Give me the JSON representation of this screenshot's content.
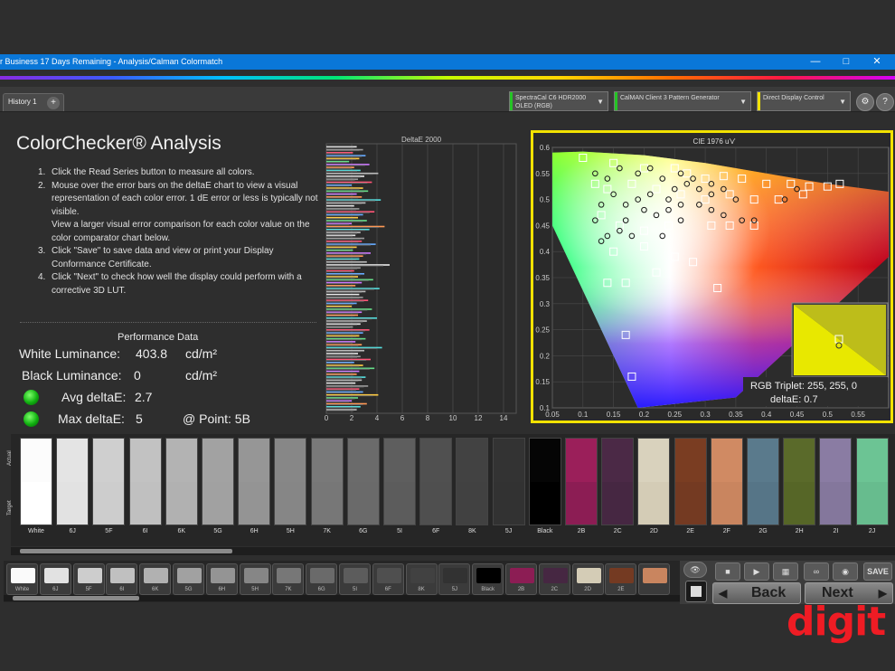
{
  "window": {
    "title": "r Business 17 Days Remaining  - Analysis/Calman Colormatch",
    "minimize_icon": "minimize-icon",
    "maximize_icon": "maximize-icon",
    "close_icon": "close-icon"
  },
  "tabs": {
    "history_label": "History 1",
    "add_icon": "plus-icon"
  },
  "devices": [
    {
      "line1": "SpectraCal C6 HDR2000",
      "line2": "OLED (RGB)",
      "color": "#25c425"
    },
    {
      "line1": "CalMAN Client 3 Pattern Generator",
      "line2": "",
      "color": "#25c425"
    },
    {
      "line1": "Direct Display Control",
      "line2": "",
      "color": "#f2e200"
    }
  ],
  "page": {
    "title": "ColorChecker® Analysis",
    "steps": [
      {
        "num": "1.",
        "text": "Click the Read Series button to measure all colors."
      },
      {
        "num": "2.",
        "text": "Mouse over the error bars on the deltaE chart to view a visual representation of each color error. 1 dE error or less is typically not visible."
      },
      {
        "num": "",
        "text": "View a larger visual error comparison for each color value on the color comparator chart below."
      },
      {
        "num": "3.",
        "text": "Click \"Save\" to save data and view or print your Display Conformance Certificate."
      },
      {
        "num": "4.",
        "text": "Click \"Next\" to check how well the display could perform with a corrective 3D LUT."
      }
    ]
  },
  "performance": {
    "title": "Performance Data",
    "white_label": "White Luminance:",
    "white_value": "403.8",
    "white_unit": "cd/m²",
    "black_label": "Black Luminance:",
    "black_value": "0",
    "black_unit": "cd/m²",
    "avg_label": "Avg deltaE:",
    "avg_value": "2.7",
    "max_label": "Max deltaE:",
    "max_value": "5",
    "point_label": "@ Point: 5B"
  },
  "chart_data": [
    {
      "type": "bar",
      "orientation": "horizontal",
      "title": "DeltaE 2000",
      "xlim": [
        0,
        15
      ],
      "xticks": [
        "0",
        "2",
        "4",
        "6",
        "8",
        "10",
        "12",
        "14"
      ],
      "values": [
        2.4,
        2.9,
        2.1,
        3.1,
        2.6,
        1.8,
        3.4,
        2.2,
        2.7,
        4.1,
        3.0,
        2.5,
        3.6,
        2.0,
        2.9,
        3.3,
        2.4,
        2.8,
        4.3,
        3.1,
        2.2,
        2.6,
        3.8,
        2.9,
        2.5,
        3.2,
        2.0,
        4.6,
        3.4,
        2.7,
        2.3,
        3.0,
        2.8,
        3.9,
        2.4,
        2.1,
        3.5,
        2.9,
        2.6,
        3.2,
        5.0,
        2.7,
        2.2,
        3.0,
        2.5,
        3.7,
        2.8,
        2.3,
        4.2,
        3.1,
        2.6,
        2.9,
        3.3,
        2.4,
        2.0,
        3.6,
        2.8,
        2.5,
        4.0,
        3.2,
        2.7,
        2.1,
        3.4,
        2.9,
        2.6,
        3.1,
        2.3,
        2.8,
        4.4,
        3.0,
        2.5,
        2.7,
        3.5,
        2.2,
        2.9,
        3.8,
        2.6,
        2.4,
        3.1,
        2.8,
        2.3,
        3.3,
        2.6,
        2.9,
        4.1,
        2.5,
        2.0,
        3.2,
        2.7,
        2.4
      ]
    },
    {
      "type": "scatter",
      "title": "CIE 1976 u'v'",
      "xlim": [
        0.05,
        0.6
      ],
      "ylim": [
        0.1,
        0.6
      ],
      "xticks": [
        "0.05",
        "0.1",
        "0.15",
        "0.2",
        "0.25",
        "0.3",
        "0.35",
        "0.4",
        "0.45",
        "0.5",
        "0.55"
      ],
      "yticks": [
        "0.1",
        "0.15",
        "0.2",
        "0.25",
        "0.3",
        "0.35",
        "0.4",
        "0.45",
        "0.5",
        "0.55",
        "0.6"
      ],
      "series": [
        {
          "marker": "square",
          "points": [
            [
              0.1,
              0.58
            ],
            [
              0.15,
              0.57
            ],
            [
              0.2,
              0.56
            ],
            [
              0.25,
              0.56
            ],
            [
              0.27,
              0.55
            ],
            [
              0.3,
              0.54
            ],
            [
              0.33,
              0.545
            ],
            [
              0.36,
              0.54
            ],
            [
              0.4,
              0.53
            ],
            [
              0.44,
              0.53
            ],
            [
              0.47,
              0.525
            ],
            [
              0.5,
              0.525
            ],
            [
              0.52,
              0.53
            ],
            [
              0.46,
              0.51
            ],
            [
              0.42,
              0.5
            ],
            [
              0.38,
              0.5
            ],
            [
              0.34,
              0.51
            ],
            [
              0.3,
              0.5
            ],
            [
              0.26,
              0.51
            ],
            [
              0.22,
              0.52
            ],
            [
              0.18,
              0.53
            ],
            [
              0.14,
              0.52
            ],
            [
              0.12,
              0.53
            ],
            [
              0.13,
              0.47
            ],
            [
              0.16,
              0.45
            ],
            [
              0.2,
              0.44
            ],
            [
              0.24,
              0.45
            ],
            [
              0.31,
              0.45
            ],
            [
              0.34,
              0.45
            ],
            [
              0.38,
              0.45
            ],
            [
              0.15,
              0.4
            ],
            [
              0.2,
              0.41
            ],
            [
              0.25,
              0.39
            ],
            [
              0.28,
              0.38
            ],
            [
              0.17,
              0.34
            ],
            [
              0.14,
              0.34
            ],
            [
              0.22,
              0.36
            ],
            [
              0.32,
              0.33
            ],
            [
              0.17,
              0.24
            ],
            [
              0.18,
              0.16
            ]
          ]
        },
        {
          "marker": "circle",
          "points": [
            [
              0.12,
              0.55
            ],
            [
              0.14,
              0.54
            ],
            [
              0.16,
              0.56
            ],
            [
              0.19,
              0.55
            ],
            [
              0.21,
              0.56
            ],
            [
              0.23,
              0.54
            ],
            [
              0.26,
              0.55
            ],
            [
              0.28,
              0.54
            ],
            [
              0.31,
              0.53
            ],
            [
              0.33,
              0.52
            ],
            [
              0.29,
              0.52
            ],
            [
              0.27,
              0.53
            ],
            [
              0.25,
              0.52
            ],
            [
              0.24,
              0.5
            ],
            [
              0.21,
              0.51
            ],
            [
              0.19,
              0.5
            ],
            [
              0.17,
              0.49
            ],
            [
              0.15,
              0.51
            ],
            [
              0.13,
              0.49
            ],
            [
              0.12,
              0.46
            ],
            [
              0.14,
              0.43
            ],
            [
              0.17,
              0.46
            ],
            [
              0.2,
              0.48
            ],
            [
              0.24,
              0.48
            ],
            [
              0.26,
              0.49
            ],
            [
              0.29,
              0.49
            ],
            [
              0.31,
              0.48
            ],
            [
              0.33,
              0.47
            ],
            [
              0.36,
              0.46
            ],
            [
              0.38,
              0.46
            ],
            [
              0.43,
              0.5
            ],
            [
              0.45,
              0.52
            ],
            [
              0.35,
              0.5
            ],
            [
              0.31,
              0.51
            ],
            [
              0.22,
              0.47
            ],
            [
              0.16,
              0.44
            ],
            [
              0.13,
              0.42
            ],
            [
              0.18,
              0.43
            ],
            [
              0.26,
              0.46
            ],
            [
              0.23,
              0.43
            ]
          ]
        }
      ]
    }
  ],
  "inset": {
    "triplet": "RGB Triplet: 255, 255, 0",
    "deltae": "deltaE: 0.7"
  },
  "swatches": {
    "actual_label": "Actual",
    "target_label": "Target",
    "items": [
      {
        "label": "White",
        "actual": "#fcfcfc",
        "target": "#ffffff"
      },
      {
        "label": "6J",
        "actual": "#e4e4e4",
        "target": "#e2e2e2"
      },
      {
        "label": "5F",
        "actual": "#cfcfcf",
        "target": "#cdcdcd"
      },
      {
        "label": "6I",
        "actual": "#c2c2c2",
        "target": "#c0c0c0"
      },
      {
        "label": "6K",
        "actual": "#b3b3b3",
        "target": "#b1b1b1"
      },
      {
        "label": "5G",
        "actual": "#a2a2a2",
        "target": "#a1a1a1"
      },
      {
        "label": "6H",
        "actual": "#969696",
        "target": "#949494"
      },
      {
        "label": "5H",
        "actual": "#878787",
        "target": "#868686"
      },
      {
        "label": "7K",
        "actual": "#797979",
        "target": "#777777"
      },
      {
        "label": "6G",
        "actual": "#6b6b6b",
        "target": "#6a6a6a"
      },
      {
        "label": "5I",
        "actual": "#5e5e5e",
        "target": "#5c5c5c"
      },
      {
        "label": "6F",
        "actual": "#505050",
        "target": "#4f4f4f"
      },
      {
        "label": "8K",
        "actual": "#424242",
        "target": "#414141"
      },
      {
        "label": "5J",
        "actual": "#333333",
        "target": "#323232"
      },
      {
        "label": "Black",
        "actual": "#050505",
        "target": "#000000"
      },
      {
        "label": "2B",
        "actual": "#9b1f5a",
        "target": "#8c1d54"
      },
      {
        "label": "2C",
        "actual": "#4b2946",
        "target": "#462742"
      },
      {
        "label": "2D",
        "actual": "#d9d2bd",
        "target": "#d4ccb6"
      },
      {
        "label": "2E",
        "actual": "#7a3d22",
        "target": "#743a22"
      },
      {
        "label": "2F",
        "actual": "#d08a63",
        "target": "#c9855f"
      },
      {
        "label": "2G",
        "actual": "#5a7a8c",
        "target": "#567587"
      },
      {
        "label": "2H",
        "actual": "#5a6a2a",
        "target": "#566627"
      },
      {
        "label": "2I",
        "actual": "#8a7ca3",
        "target": "#84779c"
      },
      {
        "label": "2J",
        "actual": "#6cc494",
        "target": "#67bc8e"
      }
    ]
  },
  "minis": [
    {
      "label": "White",
      "color": "#fafafa"
    },
    {
      "label": "6J",
      "color": "#e2e2e2"
    },
    {
      "label": "5F",
      "color": "#cdcdcd"
    },
    {
      "label": "6I",
      "color": "#c0c0c0"
    },
    {
      "label": "6K",
      "color": "#b1b1b1"
    },
    {
      "label": "5G",
      "color": "#a1a1a1"
    },
    {
      "label": "6H",
      "color": "#949494"
    },
    {
      "label": "5H",
      "color": "#868686"
    },
    {
      "label": "7K",
      "color": "#777777"
    },
    {
      "label": "6G",
      "color": "#6a6a6a"
    },
    {
      "label": "5I",
      "color": "#5c5c5c"
    },
    {
      "label": "6F",
      "color": "#4f4f4f"
    },
    {
      "label": "8K",
      "color": "#414141"
    },
    {
      "label": "5J",
      "color": "#323232"
    },
    {
      "label": "Black",
      "color": "#000000"
    },
    {
      "label": "2B",
      "color": "#8c1d54"
    },
    {
      "label": "2C",
      "color": "#462742"
    },
    {
      "label": "2D",
      "color": "#d4ccb6"
    },
    {
      "label": "2E",
      "color": "#743a22"
    },
    {
      "label": "",
      "color": "#c9855f"
    }
  ],
  "controls": {
    "back_label": "Back",
    "next_label": "Next",
    "save_label": "SAVE"
  },
  "logo": {
    "text": "digit"
  }
}
